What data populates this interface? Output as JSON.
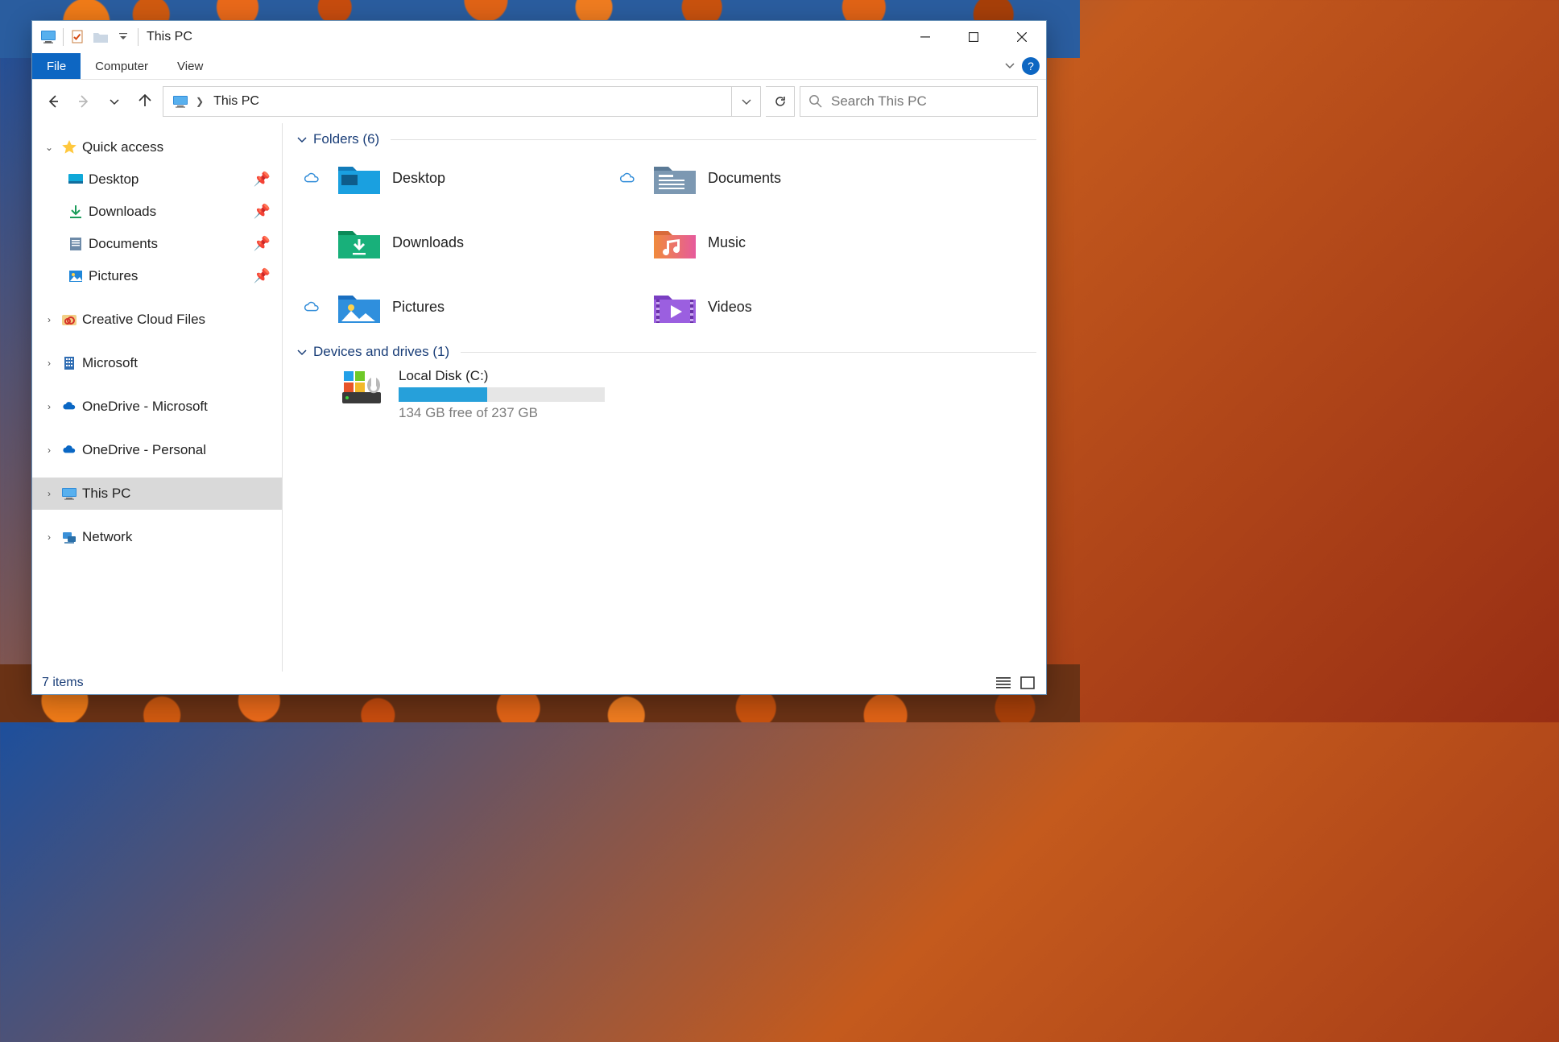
{
  "window": {
    "title": "This PC"
  },
  "ribbon": {
    "file": "File",
    "computer": "Computer",
    "view": "View"
  },
  "address": {
    "location": "This PC",
    "search_placeholder": "Search This PC"
  },
  "sidebar": {
    "quick_access": "Quick access",
    "items": [
      {
        "label": "Desktop"
      },
      {
        "label": "Downloads"
      },
      {
        "label": "Documents"
      },
      {
        "label": "Pictures"
      }
    ],
    "creative_cloud": "Creative Cloud Files",
    "microsoft": "Microsoft",
    "onedrive_ms": "OneDrive - Microsoft",
    "onedrive_personal": "OneDrive - Personal",
    "this_pc": "This PC",
    "network": "Network"
  },
  "content": {
    "folders_header": "Folders (6)",
    "devices_header": "Devices and drives (1)",
    "folders": [
      {
        "label": "Desktop"
      },
      {
        "label": "Documents"
      },
      {
        "label": "Downloads"
      },
      {
        "label": "Music"
      },
      {
        "label": "Pictures"
      },
      {
        "label": "Videos"
      }
    ],
    "drive": {
      "name": "Local Disk (C:)",
      "free_text": "134 GB free of 237 GB",
      "fill_pct": 43
    }
  },
  "statusbar": {
    "items_text": "7 items"
  }
}
